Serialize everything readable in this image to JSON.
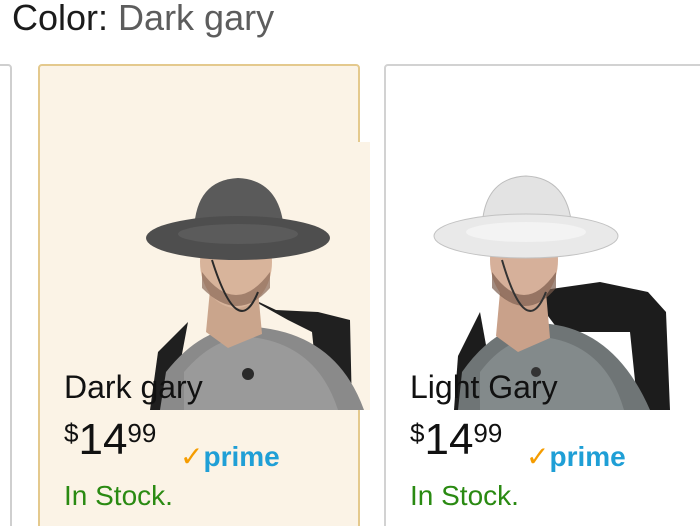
{
  "header": {
    "label": "Color:",
    "value": "Dark gary"
  },
  "swatches": [
    {
      "name": "Dark gary",
      "price_currency": "$",
      "price_whole": "14",
      "price_fraction": "99",
      "prime_label": "prime",
      "stock": "In Stock.",
      "selected": true
    },
    {
      "name": "Light Gary",
      "price_currency": "$",
      "price_whole": "14",
      "price_fraction": "99",
      "prime_label": "prime",
      "stock": "In Stock.",
      "selected": false
    }
  ],
  "colors": {
    "selected_bg": "#fbf3e6",
    "selected_border": "#e4c98d",
    "prime_blue": "#1f9fd6",
    "prime_check": "#f59c00",
    "stock_green": "#2a8a12"
  }
}
